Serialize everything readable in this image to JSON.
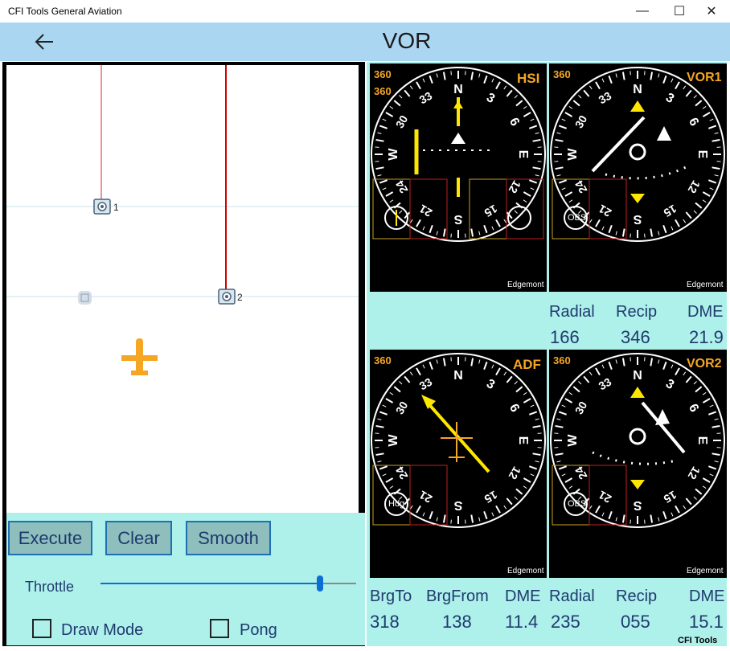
{
  "window": {
    "title": "CFI Tools General Aviation",
    "minimize": "—",
    "maximize": "☐",
    "close": "✕"
  },
  "header": {
    "back_icon": "back-arrow-icon",
    "title": "VOR"
  },
  "map": {
    "waypoint1": "1",
    "waypoint2": "2"
  },
  "controls": {
    "execute": "Execute",
    "clear": "Clear",
    "smooth": "Smooth",
    "throttle_label": "Throttle",
    "throttle_value": 0.86,
    "draw_mode": "Draw Mode",
    "pong": "Pong"
  },
  "instruments": {
    "hsi": {
      "label": "HSI",
      "heading1": "360",
      "heading2": "360",
      "brand": "Edgemont"
    },
    "vor1": {
      "label": "VOR1",
      "heading": "360",
      "obs": "OBS",
      "brand": "Edgemont"
    },
    "adf": {
      "label": "ADF",
      "heading": "360",
      "hdg": "Hdg",
      "brand": "Edgemont"
    },
    "vor2": {
      "label": "VOR2",
      "heading": "360",
      "obs": "OBS",
      "brand": "Edgemont"
    }
  },
  "readout_top": {
    "radial_label": "Radial",
    "recip_label": "Recip",
    "dme_label": "DME",
    "radial": "166",
    "recip": "346",
    "dme": "21.9"
  },
  "readout_bottom": {
    "brgto_label": "BrgTo",
    "brgfrom_label": "BrgFrom",
    "dme1_label": "DME",
    "brgto": "318",
    "brgfrom": "138",
    "dme1": "11.4",
    "radial_label": "Radial",
    "recip_label": "Recip",
    "dme2_label": "DME",
    "radial": "235",
    "recip": "055",
    "dme2": "15.1"
  },
  "footer": {
    "brand": "CFI Tools"
  },
  "colors": {
    "accent": "#abd6f2",
    "panel": "#aef0ea",
    "instrument_text": "#f5a623",
    "needle": "#ffe600"
  }
}
